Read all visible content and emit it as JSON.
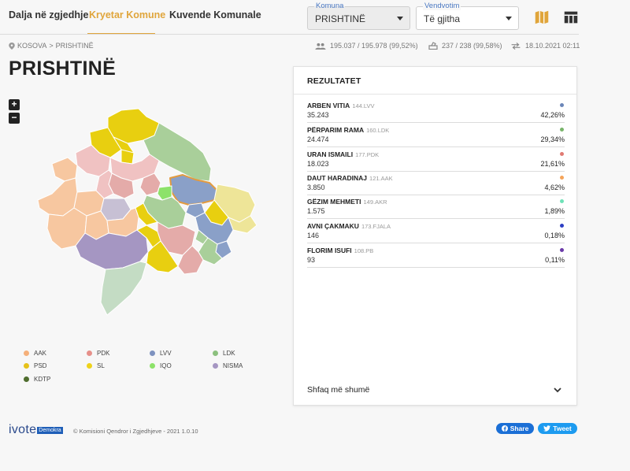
{
  "nav": {
    "tabs": [
      {
        "label": "Dalja në zgjedhje",
        "active": false
      },
      {
        "label": "Kryetar Komune",
        "active": true
      },
      {
        "label": "Kuvende Komunale",
        "active": false
      }
    ]
  },
  "filters": {
    "komuna": {
      "legend": "Komuna",
      "value": "PRISHTINË"
    },
    "vendvotim": {
      "legend": "Vendvotim",
      "value": "Të gjitha"
    }
  },
  "toolbar": {
    "map_icon": "map-icon",
    "table_icon": "table-icon"
  },
  "breadcrumb": {
    "level1": "KOSOVA",
    "separator": ">",
    "level2": "PRISHTINË"
  },
  "stats": {
    "voters": "195.037 / 195.978 (99,52%)",
    "stations": "237 / 238 (99,58%)",
    "updated": "18.10.2021 02:11"
  },
  "page_title": "PRISHTINË",
  "zoom": {
    "in": "+",
    "out": "−"
  },
  "results": {
    "title": "REZULTATET",
    "candidates": [
      {
        "name": "ARBEN VITIA",
        "party": "144.LVV",
        "votes": "35.243",
        "percent": "42,26%",
        "color": "#6b86b8"
      },
      {
        "name": "PËRPARIM RAMA",
        "party": "160.LDK",
        "votes": "24.474",
        "percent": "29,34%",
        "color": "#78b46a"
      },
      {
        "name": "URAN ISMAILI",
        "party": "177.PDK",
        "votes": "18.023",
        "percent": "21,61%",
        "color": "#e07a72"
      },
      {
        "name": "DAUT HARADINAJ",
        "party": "121.AAK",
        "votes": "3.850",
        "percent": "4,62%",
        "color": "#f5a45a"
      },
      {
        "name": "GËZIM MEHMETI",
        "party": "149.AKR",
        "votes": "1.575",
        "percent": "1,89%",
        "color": "#6fe2b8"
      },
      {
        "name": "AVNI ÇAKMAKU",
        "party": "173.FJALA",
        "votes": "146",
        "percent": "0,18%",
        "color": "#2d3fc4"
      },
      {
        "name": "FLORIM ISUFI",
        "party": "108.PB",
        "votes": "93",
        "percent": "0,11%",
        "color": "#6a3aa8"
      }
    ],
    "show_more": "Shfaq më shumë"
  },
  "legend": [
    {
      "label": "AAK",
      "color": "#f5b07a"
    },
    {
      "label": "PDK",
      "color": "#e6908a"
    },
    {
      "label": "LVV",
      "color": "#7e92bf"
    },
    {
      "label": "LDK",
      "color": "#8cc07e"
    },
    {
      "label": "PSD",
      "color": "#e6c21a"
    },
    {
      "label": "SL",
      "color": "#eed21a"
    },
    {
      "label": "IQO",
      "color": "#8de26a"
    },
    {
      "label": "NISMA",
      "color": "#a596c2"
    },
    {
      "label": "KDTP",
      "color": "#4f6d2e"
    }
  ],
  "footer": {
    "logo": "ivote",
    "logo_badge": "Demokra",
    "copyright": "© Komisioni Qendror i Zgjedhjeve - 2021 1.0.10",
    "share": "Share",
    "tweet": "Tweet"
  }
}
